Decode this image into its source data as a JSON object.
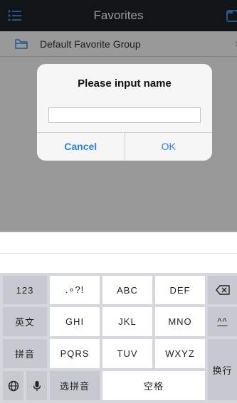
{
  "nav": {
    "title": "Favorites",
    "left_icon": "list-menu-icon",
    "right_icon": "add-folder-icon"
  },
  "list": {
    "items": [
      {
        "label": "Default Favorite Group",
        "icon": "folder-icon",
        "chevron": "›"
      }
    ]
  },
  "dialog": {
    "title": "Please input name",
    "input_value": "",
    "cancel_label": "Cancel",
    "ok_label": "OK"
  },
  "keyboard": {
    "row1": [
      "123",
      ".∘?!",
      "ABC",
      "DEF"
    ],
    "row2": [
      "英文",
      "GHI",
      "JKL",
      "MNO"
    ],
    "row3": [
      "拼音",
      "PQRS",
      "TUV",
      "WXYZ"
    ],
    "row4": [
      "选拼音",
      "空格"
    ],
    "enter_label": "换行",
    "backspace_icon": "backspace-icon",
    "emoji_label": "^^",
    "globe_icon": "globe-icon",
    "mic_icon": "microphone-icon"
  },
  "colors": {
    "navbar": "#1f2429",
    "accent": "#2a7ff0",
    "overlay": "rgba(0,0,0,0.40)",
    "keyboard_bg": "#d4d7db",
    "side_key": "#c6cad0"
  }
}
